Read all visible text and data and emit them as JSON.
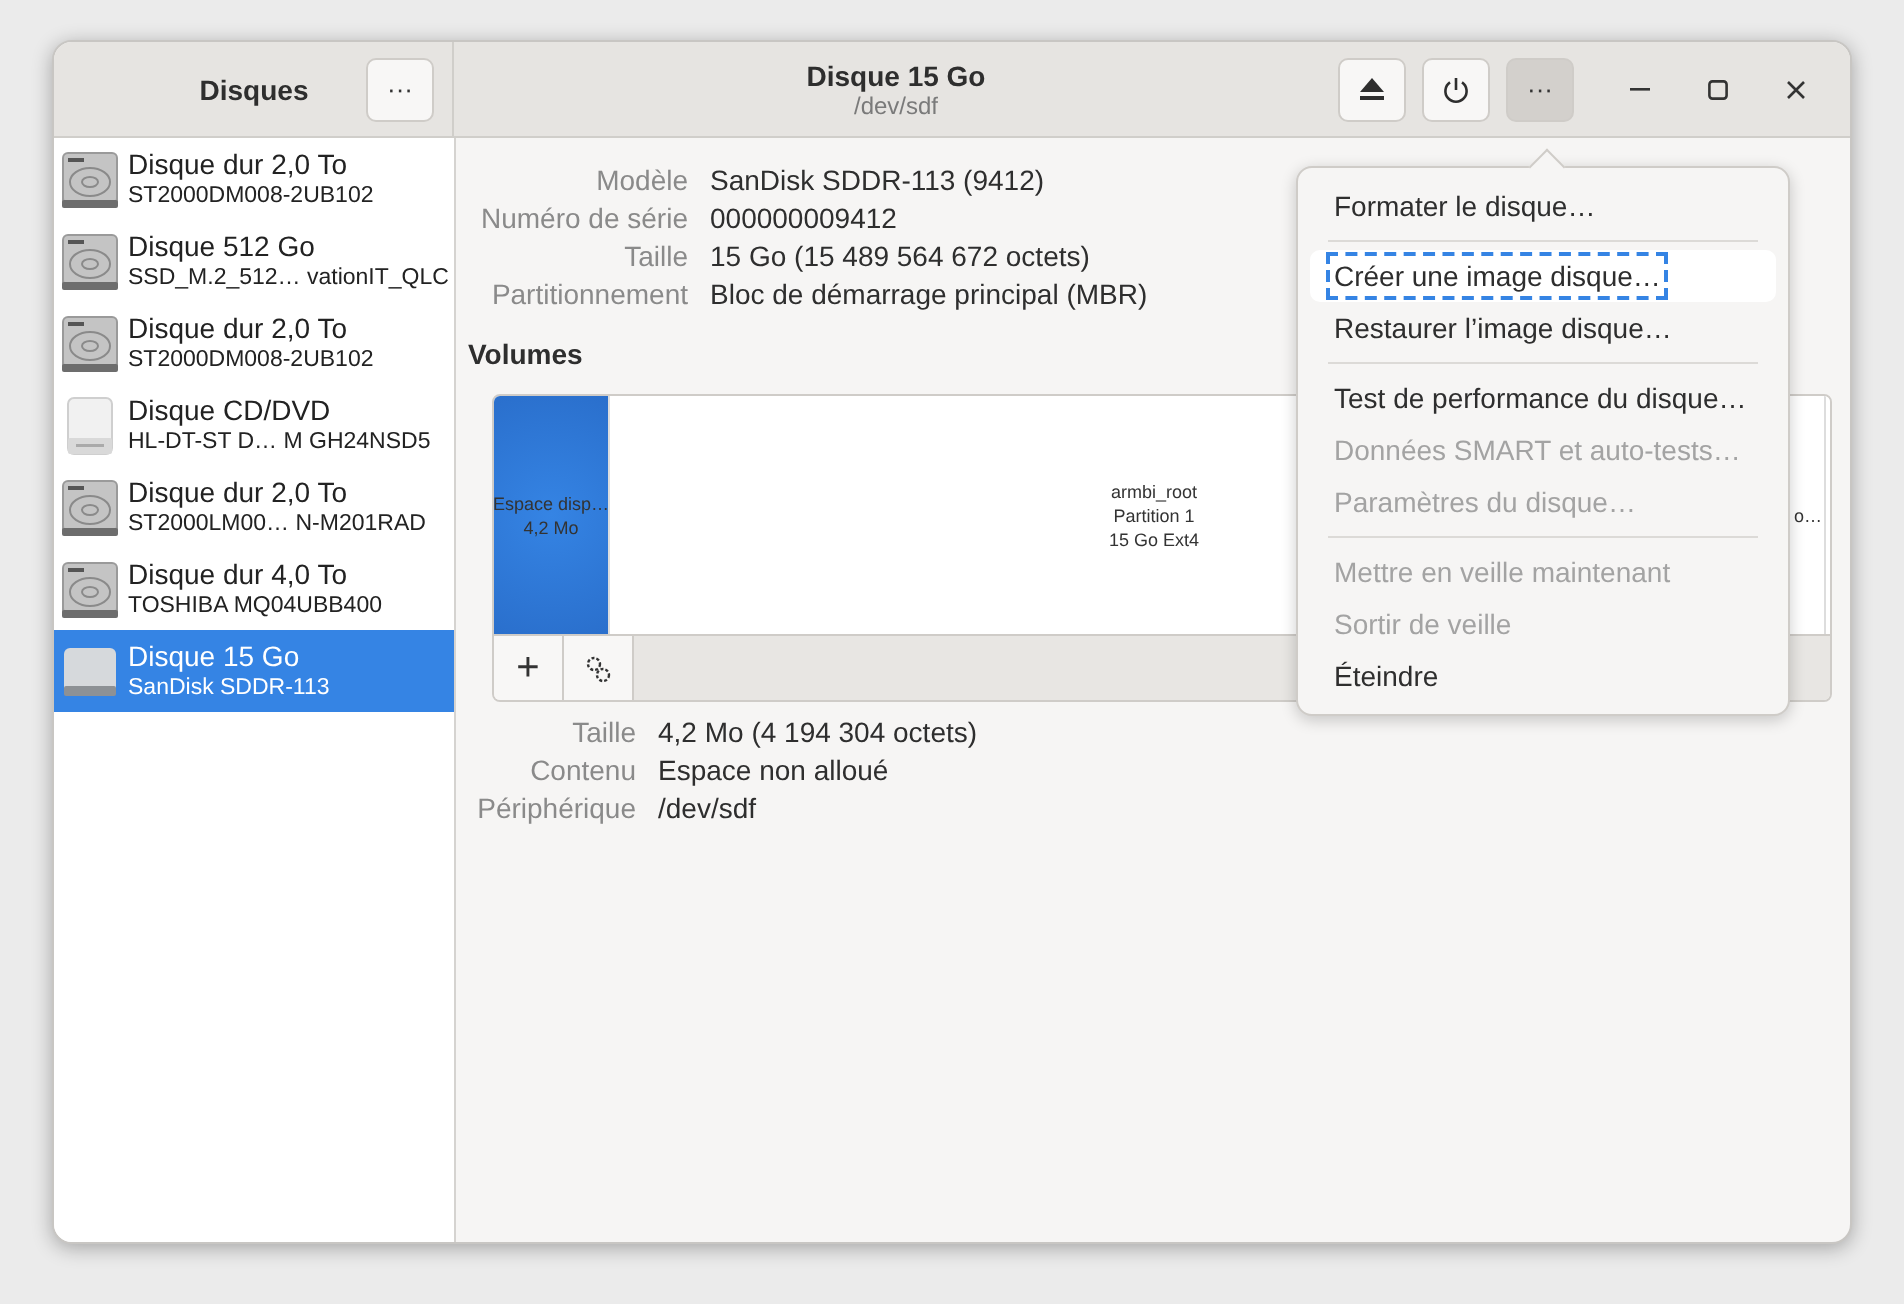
{
  "sidebar": {
    "title": "Disques",
    "menu_button": "···",
    "items": [
      {
        "kind": "hdd",
        "name": "Disque dur 2,0 To",
        "model": "ST2000DM008-2UB102",
        "selected": false
      },
      {
        "kind": "hdd",
        "name": "Disque 512 Go",
        "model": "SSD_M.2_512… vationIT_QLC",
        "selected": false
      },
      {
        "kind": "hdd",
        "name": "Disque dur 2,0 To",
        "model": "ST2000DM008-2UB102",
        "selected": false
      },
      {
        "kind": "optical",
        "name": "Disque CD/DVD",
        "model": "HL-DT-ST D… M GH24NSD5",
        "selected": false
      },
      {
        "kind": "hdd",
        "name": "Disque dur 2,0 To",
        "model": "ST2000LM00… N-M201RAD",
        "selected": false
      },
      {
        "kind": "hdd",
        "name": "Disque dur 4,0 To",
        "model": "TOSHIBA MQ04UBB400",
        "selected": false
      },
      {
        "kind": "removable",
        "name": "Disque 15 Go",
        "model": "SanDisk SDDR-113",
        "selected": true
      }
    ]
  },
  "header": {
    "title": "Disque 15 Go",
    "subtitle": "/dev/sdf",
    "menu_button": "···",
    "menu_open": true
  },
  "disk_info": [
    {
      "label": "Modèle",
      "value": "SanDisk SDDR-113 (9412)"
    },
    {
      "label": "Numéro de série",
      "value": "000000009412"
    },
    {
      "label": "Taille",
      "value": "15 Go (15 489 564 672 octets)"
    },
    {
      "label": "Partitionnement",
      "value": "Bloc de démarrage principal (MBR)"
    }
  ],
  "volumes": {
    "title": "Volumes",
    "segments": [
      {
        "kind": "free",
        "lines": [
          "Espace disp…",
          "4,2 Mo"
        ],
        "selected": true
      },
      {
        "kind": "partition",
        "lines": [
          "armbi_root",
          "Partition 1",
          "15 Go Ext4"
        ],
        "selected": false
      },
      {
        "kind": "free",
        "lines": [
          "o…"
        ],
        "selected": false
      }
    ],
    "add_button": "+"
  },
  "volume_info": [
    {
      "label": "Taille",
      "value": "4,2 Mo (4 194 304 octets)"
    },
    {
      "label": "Contenu",
      "value": "Espace non alloué"
    },
    {
      "label": "Périphérique",
      "value": "/dev/sdf"
    }
  ],
  "menu": [
    [
      {
        "label": "Formater le disque…",
        "disabled": false,
        "focused": false
      }
    ],
    [
      {
        "label": "Créer une image disque…",
        "disabled": false,
        "focused": true
      },
      {
        "label": "Restaurer l’image disque…",
        "disabled": false,
        "focused": false
      }
    ],
    [
      {
        "label": "Test de performance du disque…",
        "disabled": false,
        "focused": false
      },
      {
        "label": "Données SMART et auto-tests…",
        "disabled": true,
        "focused": false
      },
      {
        "label": "Paramètres du disque…",
        "disabled": true,
        "focused": false
      }
    ],
    [
      {
        "label": "Mettre en veille maintenant",
        "disabled": true,
        "focused": false
      },
      {
        "label": "Sortir de veille",
        "disabled": true,
        "focused": false
      },
      {
        "label": "Éteindre",
        "disabled": false,
        "focused": false
      }
    ]
  ]
}
